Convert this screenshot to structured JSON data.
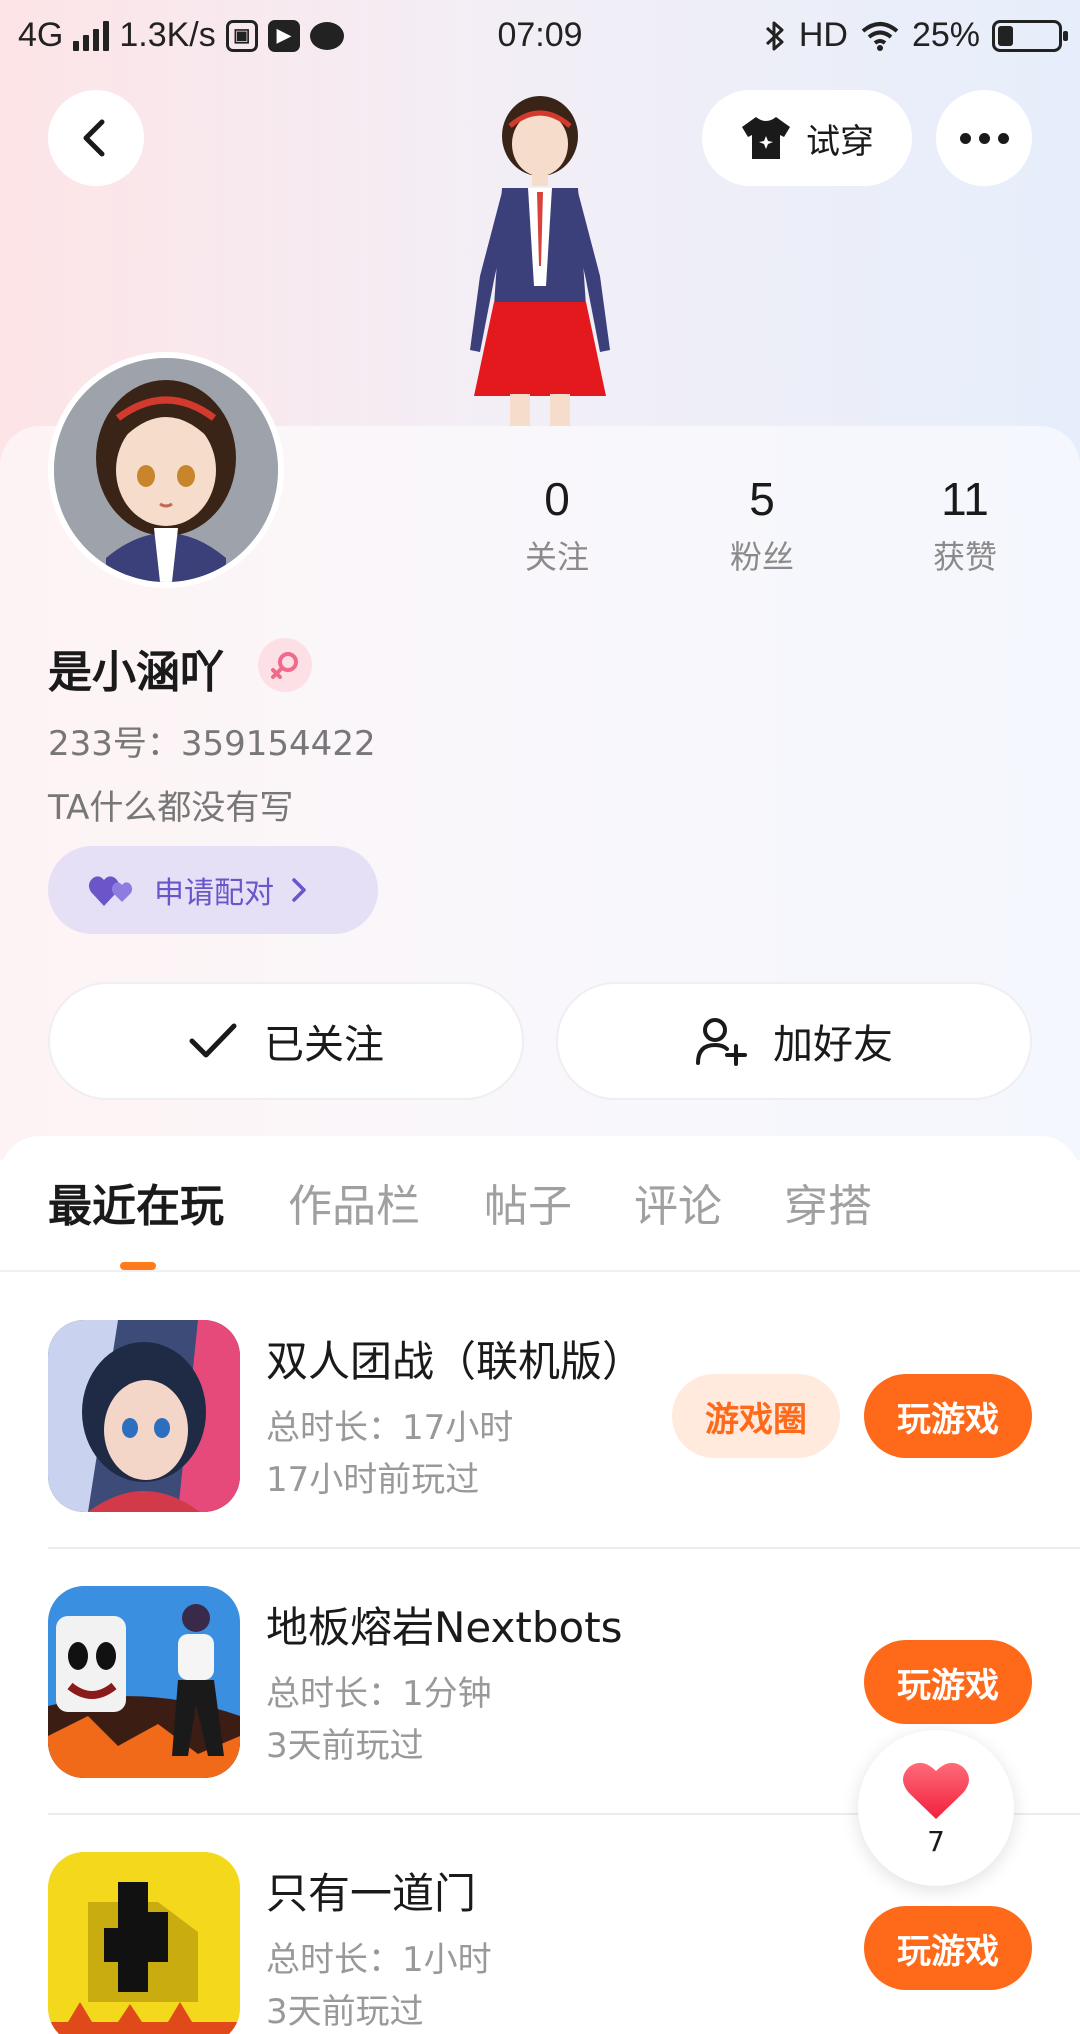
{
  "status_bar": {
    "network": "4G",
    "speed": "1.3K/s",
    "time": "07:09",
    "hd": "HD",
    "battery": "25%",
    "battery_level": 0.25
  },
  "header": {
    "tryon_label": "试穿"
  },
  "profile": {
    "username": "是小涵吖",
    "user_id": "233号：359154422",
    "bio": "TA什么都没有写",
    "pair_label": "申请配对",
    "stats": [
      {
        "value": "0",
        "label": "关注"
      },
      {
        "value": "5",
        "label": "粉丝"
      },
      {
        "value": "11",
        "label": "获赞"
      }
    ],
    "follow_label": "已关注",
    "add_friend_label": "加好友"
  },
  "tabs": [
    "最近在玩",
    "作品栏",
    "帖子",
    "评论",
    "穿搭"
  ],
  "games": [
    {
      "title": "双人团战（联机版）",
      "duration": "总时长：17小时",
      "last_played": "17小时前玩过",
      "circle_label": "游戏圈",
      "play_label": "玩游戏"
    },
    {
      "title": "地板熔岩Nextbots",
      "duration": "总时长：1分钟",
      "last_played": "3天前玩过",
      "play_label": "玩游戏"
    },
    {
      "title": "只有一道门",
      "duration": "总时长：1小时",
      "last_played": "3天前玩过",
      "play_label": "玩游戏"
    }
  ],
  "like_count": "7",
  "colors": {
    "accent_orange": "#ff6a1a",
    "pair_purple": "#6b55c9",
    "gender_pink": "#f06a8c"
  },
  "icons": {
    "back": "chevron-left-icon",
    "tryon": "tshirt-icon",
    "more": "more-dots-icon",
    "gender": "female-icon",
    "pair": "double-heart-icon",
    "follow": "check-icon",
    "add_friend": "user-plus-icon",
    "like": "heart-icon"
  }
}
